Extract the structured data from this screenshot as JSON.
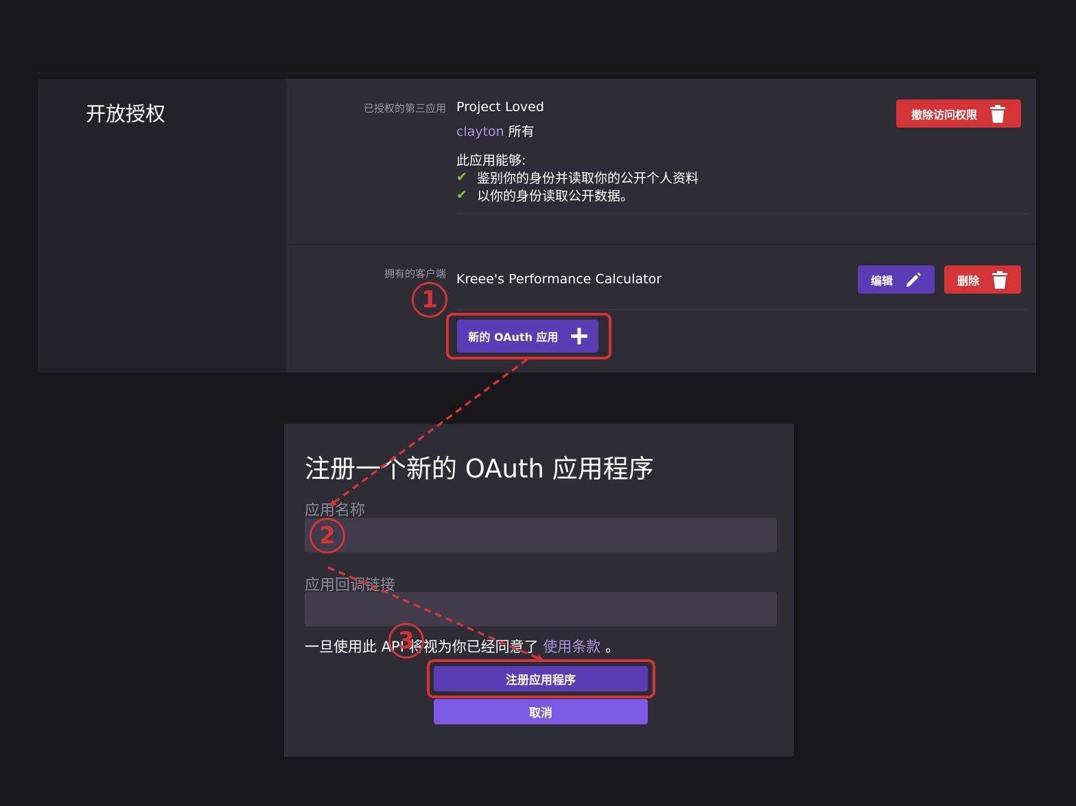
{
  "section": {
    "title": "开放授权"
  },
  "authorized_apps": {
    "label": "已授权的第三应用",
    "app_name": "Project Loved",
    "owner_name": "clayton",
    "owner_suffix": "所有",
    "permissions_title": "此应用能够:",
    "permissions": [
      "鉴别你的身份并读取你的公开个人资料",
      "以你的身份读取公开数据。"
    ],
    "revoke_label": "撤除访问权限"
  },
  "owned_clients": {
    "label": "拥有的客户端",
    "client_name": "Kreee's Performance Calculator",
    "edit_label": "编辑",
    "delete_label": "删除",
    "new_label": "新的 OAuth 应用"
  },
  "register_dialog": {
    "title": "注册一个新的 OAuth 应用程序",
    "name_label": "应用名称",
    "name_value": "",
    "callback_label": "应用回调链接",
    "callback_value": "",
    "terms_prefix": "一旦使用此 API 将视为你已经同意了",
    "terms_link": "使用条款",
    "terms_suffix": "。",
    "register_label": "注册应用程序",
    "cancel_label": "取消"
  },
  "annotations": {
    "step1": "1",
    "step2": "2",
    "step3": "3",
    "color": "#d43436"
  },
  "colors": {
    "danger": "#d43436",
    "primary": "#5a3cb4",
    "accent_link": "#a994dd",
    "check": "#86c436"
  },
  "icons": {
    "revoke": "trash-icon",
    "edit": "pencil-icon",
    "delete": "trash-icon",
    "new": "plus-icon",
    "check": "check-icon"
  }
}
